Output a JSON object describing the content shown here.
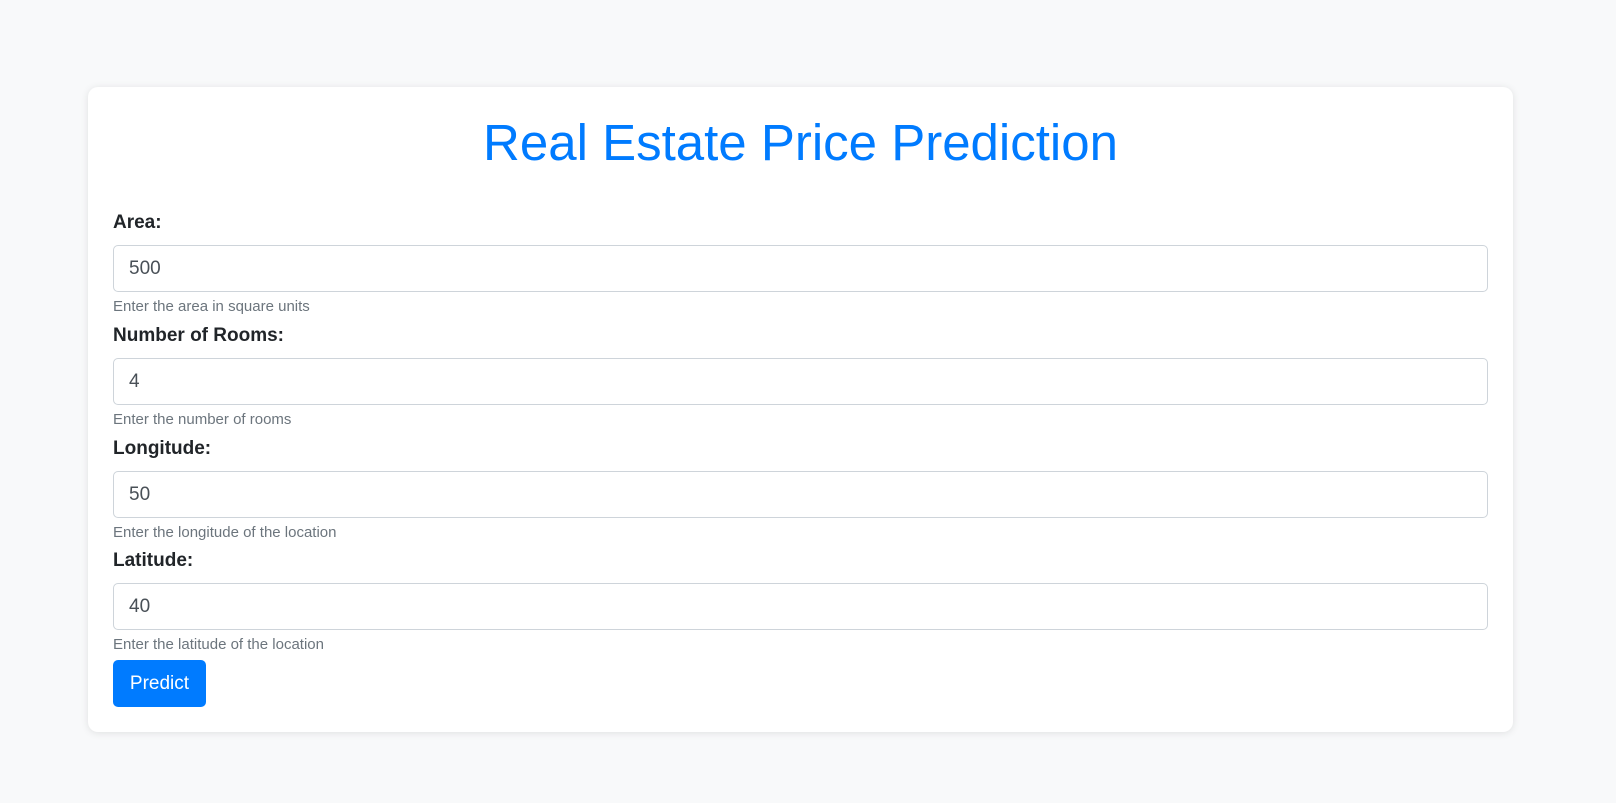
{
  "page": {
    "title": "Real Estate Price Prediction"
  },
  "form": {
    "fields": [
      {
        "label": "Area:",
        "value": "500",
        "help": "Enter the area in square units"
      },
      {
        "label": "Number of Rooms:",
        "value": "4",
        "help": "Enter the number of rooms"
      },
      {
        "label": "Longitude:",
        "value": "50",
        "help": "Enter the longitude of the location"
      },
      {
        "label": "Latitude:",
        "value": "40",
        "help": "Enter the latitude of the location"
      }
    ],
    "submit_label": "Predict"
  },
  "colors": {
    "accent": "#007bff",
    "background": "#f8f9fa",
    "help_text": "#6c757d"
  }
}
